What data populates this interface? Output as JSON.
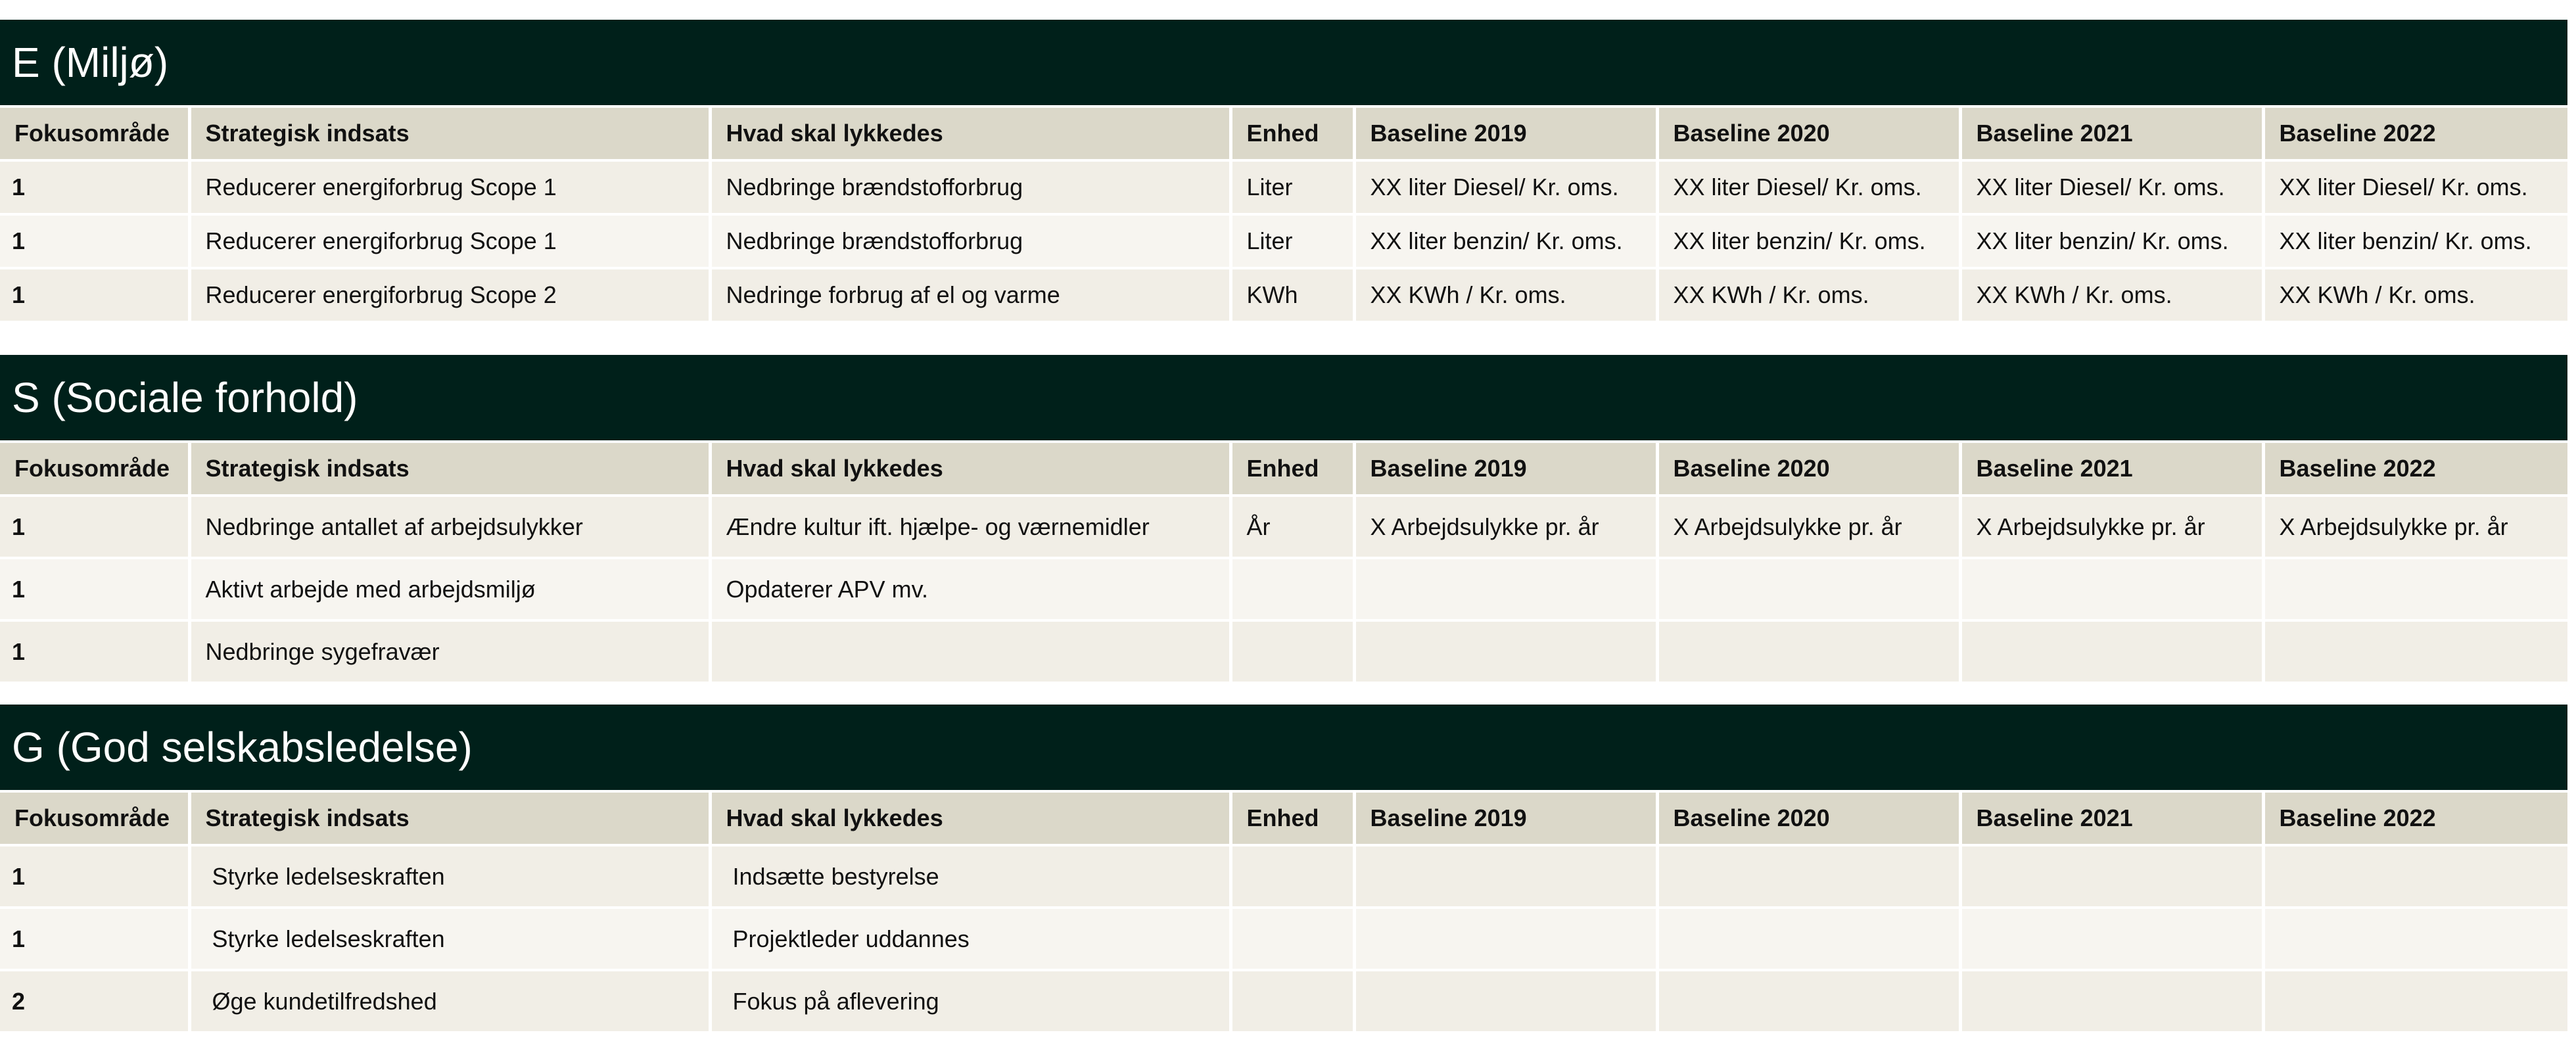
{
  "columns": [
    "Fokusområde",
    "Strategisk indsats",
    "Hvad skal lykkedes",
    "Enhed",
    "Baseline 2019",
    "Baseline 2020",
    "Baseline 2021",
    "Baseline 2022"
  ],
  "sections": [
    {
      "title": "E (Miljø)",
      "rows": [
        [
          "1",
          "Reducerer energiforbrug Scope 1",
          "Nedbringe brændstofforbrug",
          "Liter",
          "XX liter Diesel/ Kr. oms.",
          "XX liter Diesel/ Kr. oms.",
          "XX liter Diesel/ Kr. oms.",
          "XX liter Diesel/ Kr. oms."
        ],
        [
          "1",
          "Reducerer energiforbrug Scope 1",
          "Nedbringe brændstofforbrug",
          "Liter",
          "XX liter benzin/ Kr. oms.",
          "XX liter benzin/ Kr. oms.",
          "XX liter benzin/ Kr. oms.",
          "XX liter benzin/ Kr. oms."
        ],
        [
          "1",
          "Reducerer energiforbrug Scope 2",
          "Nedringe forbrug af el og varme",
          "KWh",
          "XX KWh / Kr. oms.",
          "XX KWh / Kr. oms.",
          "XX KWh / Kr. oms.",
          "XX KWh / Kr. oms."
        ]
      ]
    },
    {
      "title": "S (Sociale forhold)",
      "rows": [
        [
          "1",
          "Nedbringe antallet af arbejdsulykker",
          "Ændre kultur ift. hjælpe- og værnemidler",
          "År",
          "X Arbejdsulykke pr. år",
          "X Arbejdsulykke pr. år",
          "X Arbejdsulykke pr. år",
          "X Arbejdsulykke pr. år"
        ],
        [
          "1",
          "Aktivt arbejde med arbejdsmiljø",
          "Opdaterer APV mv.",
          "",
          "",
          "",
          "",
          ""
        ],
        [
          "1",
          "Nedbringe sygefravær",
          "",
          "",
          "",
          "",
          "",
          ""
        ]
      ]
    },
    {
      "title": "G (God selskabsledelse)",
      "rows": [
        [
          "1",
          "Styrke ledelseskraften",
          "Indsætte bestyrelse",
          "",
          "",
          "",
          "",
          ""
        ],
        [
          "1",
          "Styrke ledelseskraften",
          "Projektleder uddannes",
          "",
          "",
          "",
          "",
          ""
        ],
        [
          "2",
          "Øge kundetilfredshed",
          "Fokus på aflevering",
          "",
          "",
          "",
          "",
          ""
        ]
      ]
    }
  ]
}
